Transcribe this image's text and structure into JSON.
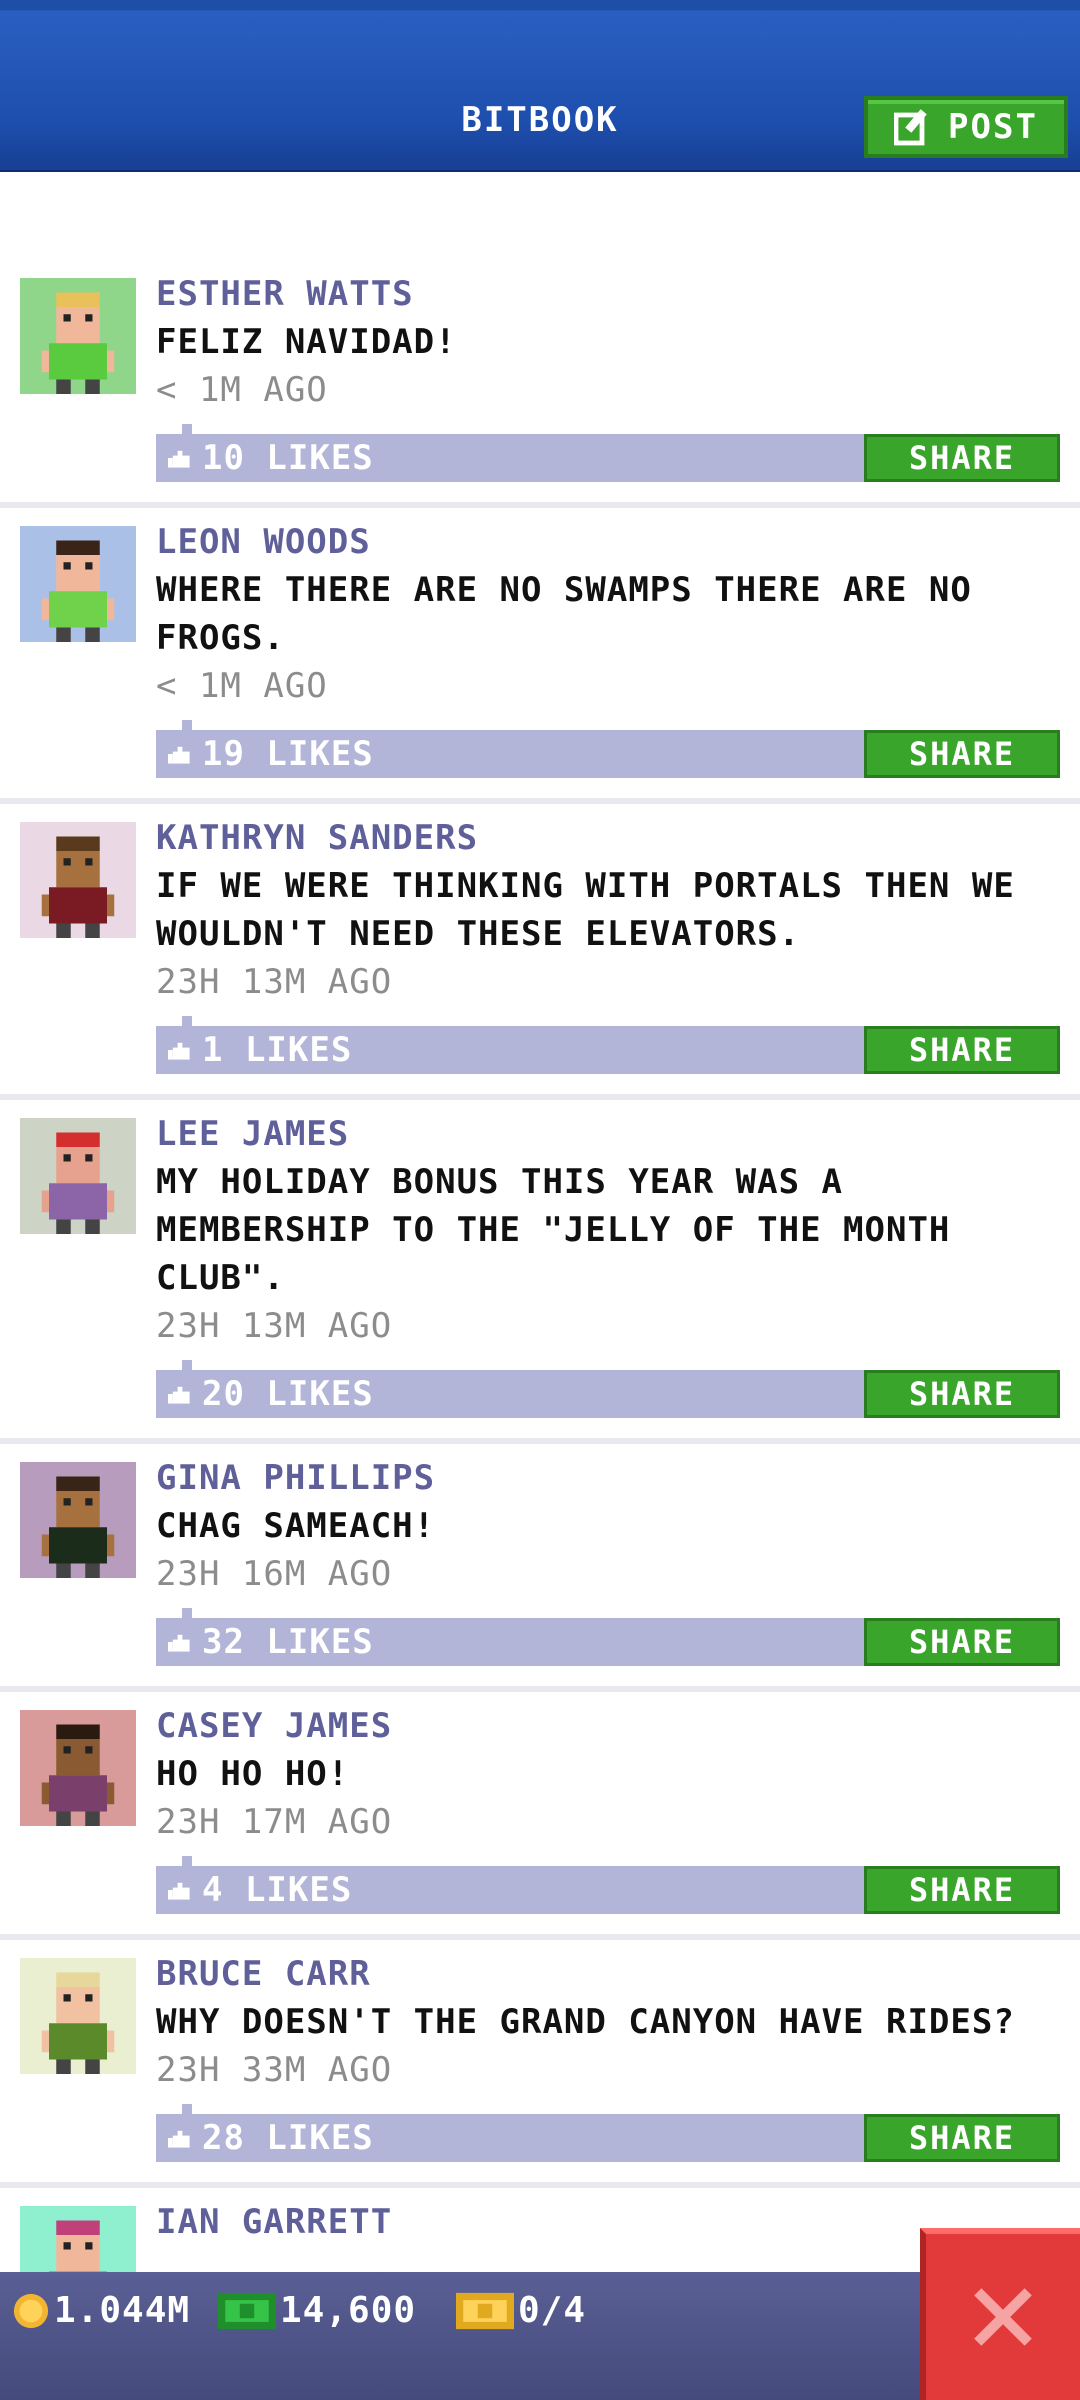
{
  "header": {
    "title": "BITBOOK",
    "post_label": "POST"
  },
  "posts": [
    {
      "author": "ESTHER WATTS",
      "message": "FELIZ NAVIDAD!",
      "time": "< 1M AGO",
      "likes": "10 LIKES",
      "share": "SHARE",
      "avatar_bg": "#8fd68a",
      "skin": "#f1b79b",
      "shirt": "#5acb3f",
      "hair": "#e8c15a"
    },
    {
      "author": "LEON WOODS",
      "message": "WHERE THERE ARE NO SWAMPS THERE ARE NO FROGS.",
      "time": "< 1M AGO",
      "likes": "19 LIKES",
      "share": "SHARE",
      "avatar_bg": "#aac0e6",
      "skin": "#f1b79b",
      "shirt": "#6fd24a",
      "hair": "#3a2418"
    },
    {
      "author": "KATHRYN SANDERS",
      "message": "IF WE WERE THINKING WITH PORTALS THEN WE WOULDN'T NEED THESE ELEVATORS.",
      "time": "23H 13M AGO",
      "likes": "1 LIKES",
      "share": "SHARE",
      "avatar_bg": "#ead8e4",
      "skin": "#a7713f",
      "shirt": "#7a1a22",
      "hair": "#5a3a1c"
    },
    {
      "author": "LEE JAMES",
      "message": "MY HOLIDAY BONUS THIS YEAR WAS A MEMBERSHIP TO THE \"JELLY OF THE MONTH CLUB\".",
      "time": "23H 13M AGO",
      "likes": "20 LIKES",
      "share": "SHARE",
      "avatar_bg": "#cdd4c6",
      "skin": "#e6a28e",
      "shirt": "#8c65a8",
      "hair": "#d42e2e"
    },
    {
      "author": "GINA PHILLIPS",
      "message": "CHAG SAMEACH!",
      "time": "23H 16M AGO",
      "likes": "32 LIKES",
      "share": "SHARE",
      "avatar_bg": "#b79cbd",
      "skin": "#a7713f",
      "shirt": "#1b2d1a",
      "hair": "#3a2418"
    },
    {
      "author": "CASEY JAMES",
      "message": "HO HO HO!",
      "time": "23H 17M AGO",
      "likes": "4 LIKES",
      "share": "SHARE",
      "avatar_bg": "#d99a9a",
      "skin": "#8a5a33",
      "shirt": "#7a3f6a",
      "hair": "#2a1a10"
    },
    {
      "author": "BRUCE CARR",
      "message": "WHY DOESN'T THE GRAND CANYON HAVE RIDES?",
      "time": "23H 33M AGO",
      "likes": "28 LIKES",
      "share": "SHARE",
      "avatar_bg": "#e9efd0",
      "skin": "#f1c1a1",
      "shirt": "#5a8a2a",
      "hair": "#e8d79a"
    },
    {
      "author": "IAN GARRETT",
      "message": "",
      "time": "",
      "likes": "",
      "share": "",
      "avatar_bg": "#8ff0d0",
      "skin": "#f1b79b",
      "shirt": "#5acb3f",
      "hair": "#c2407a"
    }
  ],
  "bottom": {
    "coins": "1.044M",
    "bux": "14,600",
    "tickets": "0/4"
  },
  "colors": {
    "accent_green": "#39a52a",
    "close_red": "#e23a3a",
    "like_bar": "#b3b5d8",
    "author_text": "#5f5f9a"
  },
  "icons": [
    "edit-icon",
    "like-icon",
    "coin-icon",
    "bux-icon",
    "ticket-icon",
    "close-icon"
  ]
}
